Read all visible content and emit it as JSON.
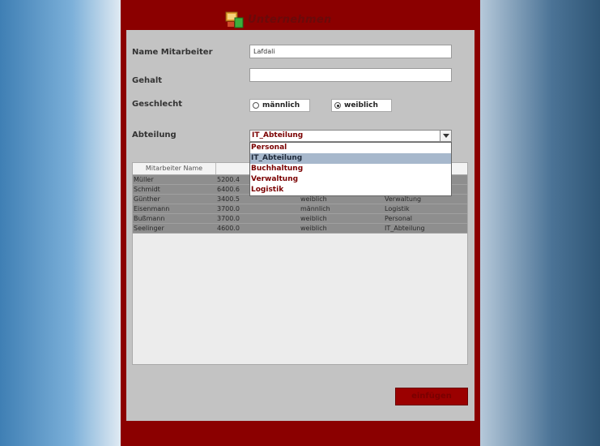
{
  "window": {
    "title": "Unternehmen"
  },
  "form": {
    "name_label": "Name Mitarbeiter",
    "name_value": "Lafdali",
    "salary_label": "Gehalt",
    "salary_value": "",
    "gender_label": "Geschlecht",
    "gender_options": [
      {
        "label": "männlich",
        "selected": false
      },
      {
        "label": "weiblich",
        "selected": true
      }
    ],
    "department_label": "Abteilung",
    "department_value": "IT_Abteilung"
  },
  "dropdown": {
    "items": [
      "Personal",
      "IT_Abteilung",
      "Buchhaltung",
      "Verwaltung",
      "Logistik"
    ],
    "highlighted": "IT_Abteilung"
  },
  "table": {
    "columns": [
      "Mitarbeiter Name",
      "",
      "",
      ""
    ],
    "rows": [
      [
        "Müller",
        "5200.4",
        "",
        ""
      ],
      [
        "Schmidt",
        "6400.6",
        "",
        ""
      ],
      [
        "Günther",
        "3400.5",
        "weiblich",
        "Verwaltung"
      ],
      [
        "Eisenmann",
        "3700.0",
        "männlich",
        "Logistik"
      ],
      [
        "Bußmann",
        "3700.0",
        "weiblich",
        "Personal"
      ],
      [
        "Seelinger",
        "4600.0",
        "weiblich",
        "IT_Abteilung"
      ]
    ]
  },
  "actions": {
    "add_label": "einfügen"
  },
  "colors": {
    "frame": "#8b0000",
    "panel": "#c3c3c3",
    "accent_text": "#7a0000",
    "selection": "#a7b8cc"
  },
  "icons": {
    "title": "company-app-icon",
    "combo": "chevron-down-icon"
  }
}
